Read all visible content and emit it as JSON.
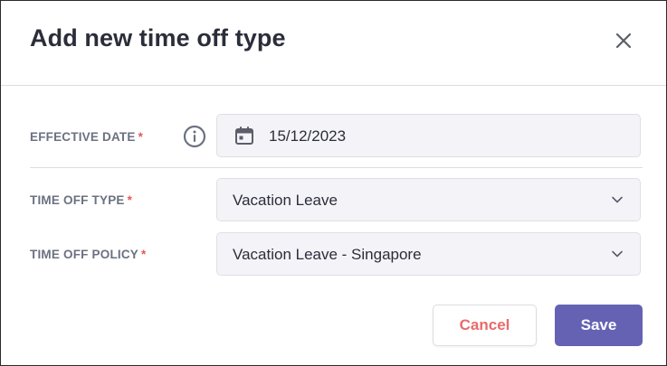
{
  "dialog": {
    "title": "Add new time off type",
    "close_icon": "close-icon"
  },
  "fields": {
    "effective_date": {
      "label": "EFFECTIVE DATE",
      "required_mark": "*",
      "info_icon": "info-icon",
      "calendar_icon": "calendar-icon",
      "value": "15/12/2023"
    },
    "time_off_type": {
      "label": "TIME OFF TYPE",
      "required_mark": "*",
      "value": "Vacation Leave",
      "chevron_icon": "chevron-down-icon"
    },
    "time_off_policy": {
      "label": "TIME OFF POLICY",
      "required_mark": "*",
      "value": "Vacation Leave - Singapore",
      "chevron_icon": "chevron-down-icon"
    }
  },
  "actions": {
    "cancel_label": "Cancel",
    "save_label": "Save"
  },
  "colors": {
    "primary": "#6562b3",
    "cancel_text": "#e86b6b",
    "required": "#e25b5b",
    "label": "#6b7180",
    "field_bg": "#f4f4f8"
  }
}
